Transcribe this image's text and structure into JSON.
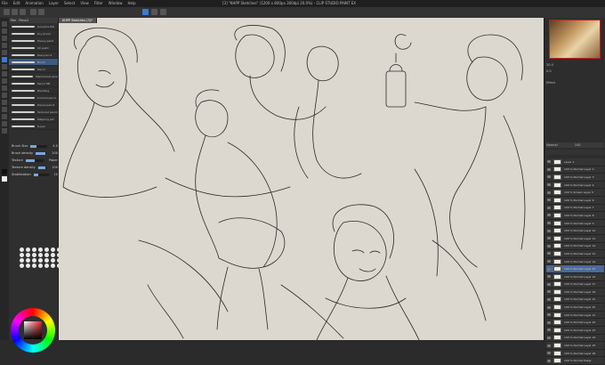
{
  "menu": [
    "File",
    "Edit",
    "Animation",
    "Layer",
    "Select",
    "View",
    "Filter",
    "Window",
    "Help"
  ],
  "window_title": "[3] \"KHPP Sketches\" (1200 x 800px 300dpi 20.0%) - CLIP STUDIO PAINT EX",
  "canvas_tabs": [
    "KHPP Sketches (3)*"
  ],
  "subtool": {
    "tabs": [
      "Pen",
      "Pencil"
    ],
    "brushes": [
      "Gouache flat",
      "Dry brush",
      "Heavy paint",
      "Oil paint",
      "Real pencil",
      "Brush",
      "Pencil",
      "Mechanical pencil",
      "Pencil HB",
      "Blending",
      "Colored pencil",
      "Dense pencil",
      "Textured pencil",
      "Mapping pen",
      "G-pen"
    ],
    "selected_index": 5
  },
  "tool_property": {
    "rows": [
      {
        "label": "Brush Size",
        "value": "4.0",
        "fill": 0.35
      },
      {
        "label": "Brush density",
        "value": "100",
        "fill": 0.9
      },
      {
        "label": "Texture",
        "value": "Paper",
        "fill": 0.5
      },
      {
        "label": "Texture density",
        "value": "100",
        "fill": 0.85
      },
      {
        "label": "Stabilization",
        "value": "10",
        "fill": 0.3
      }
    ]
  },
  "brush_size_palette_count": 28,
  "navigator": {
    "zoom": "20.0",
    "angle": "0.0"
  },
  "layer_props": {
    "label": "Effect",
    "blend": "Normal",
    "opacity": "100"
  },
  "layers": [
    "Layer 1",
    "100 % Normal Layer 2",
    "100 % Normal Layer 3",
    "100 % Normal Layer 4",
    "100 % Screen Layer 5",
    "100 % Normal Layer 6",
    "100 % Normal Layer 7",
    "100 % Normal Layer 8",
    "100 % Normal Layer 9",
    "100 % Normal Layer 10",
    "100 % Normal Layer 11",
    "100 % Normal Layer 12",
    "100 % Normal Layer 13",
    "100 % Normal Layer 14",
    "100 % Normal Layer 15",
    "100 % Normal Layer 16",
    "100 % Normal Layer 17",
    "100 % Normal Layer 18",
    "100 % Normal Layer 19",
    "100 % Normal Layer 20",
    "100 % Normal Layer 21",
    "100 % Normal Layer 22",
    "100 % Normal Layer 23",
    "100 % Normal Layer 24",
    "100 % Normal Layer 25",
    "100 % Normal Layer 26",
    "100 % Normal Paper"
  ],
  "selected_layer_index": 14,
  "colors": {
    "accent": "#3a7bd5",
    "canvas": "#dcd8cf"
  }
}
